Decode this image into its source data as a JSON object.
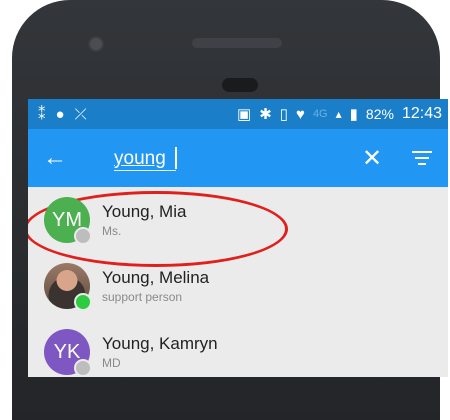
{
  "status_bar": {
    "left_icons": [
      "signal-app-icon",
      "android-icon",
      "missed-call-icon"
    ],
    "right_icons": [
      "nfc-icon",
      "bluetooth-icon",
      "vibrate-icon",
      "wifi-icon"
    ],
    "network": "4G",
    "battery": "82%",
    "time": "12:43"
  },
  "app_bar": {
    "search_value": "young",
    "colors": {
      "status": "#1a7fc8",
      "bar": "#2196f3"
    }
  },
  "contacts": [
    {
      "initials": "YM",
      "name": "Young, Mia",
      "subtitle": "Ms.",
      "avatar_color": "#4caf50",
      "status_color": "#bdbdbd"
    },
    {
      "initials": "",
      "name": "Young, Melina",
      "subtitle": "support person",
      "avatar_color": "photo",
      "status_color": "#2ecc40"
    },
    {
      "initials": "YK",
      "name": "Young, Kamryn",
      "subtitle": "MD",
      "avatar_color": "#7e57c2",
      "status_color": "#bdbdbd"
    }
  ],
  "highlight_color": "#e0201c"
}
